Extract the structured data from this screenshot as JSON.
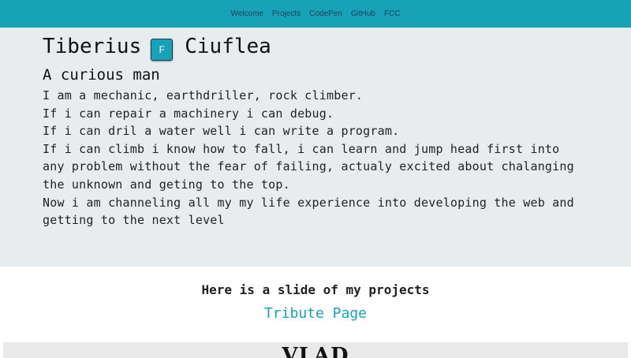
{
  "nav": {
    "items": [
      "Welcome",
      "Projects",
      "CodePen",
      "GitHub",
      "FCC"
    ]
  },
  "intro": {
    "first_name": "Tiberius",
    "badge": "F",
    "last_name": "Ciuflea",
    "subtitle": "A curious man",
    "bio_lines": [
      "I am a mechanic, earthdriller, rock climber.",
      "If i can repair a machinery i can debug.",
      "If i can dril a water well i can write a program.",
      "If i can climb i know how to fall, i can learn and jump head first into any problem without the fear of failing, actualy excited about chalanging the unknown and geting to the top.",
      "Now i am channeling all my my life experience into developing the web and getting to the next level"
    ]
  },
  "projects": {
    "heading": "Here is a slide of my projects",
    "link": "Tribute Page",
    "slide_title": "VLAD"
  },
  "colors": {
    "accent": "#17a2b8",
    "intro_bg": "#e9ecef",
    "nav_text": "#1f3d5a"
  }
}
